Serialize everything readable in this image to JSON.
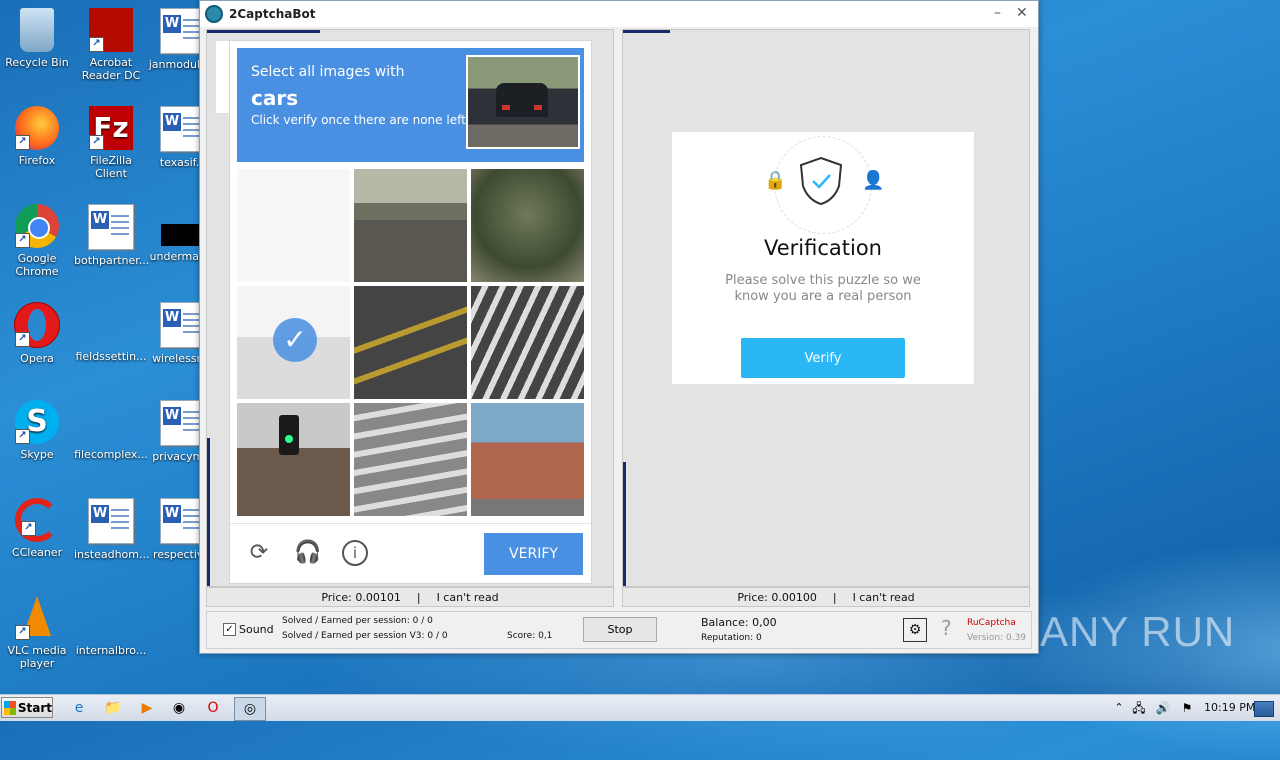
{
  "desktop": {
    "icons": [
      {
        "label": "Recycle Bin"
      },
      {
        "label": "Acrobat Reader DC"
      },
      {
        "label": "janmodule..."
      },
      {
        "label": "Firefox"
      },
      {
        "label": "FileZilla Client"
      },
      {
        "label": "texasif..."
      },
      {
        "label": "Google Chrome"
      },
      {
        "label": "bothpartner..."
      },
      {
        "label": "underman..."
      },
      {
        "label": "Opera"
      },
      {
        "label": "fieldssettin..."
      },
      {
        "label": "wirelessn..."
      },
      {
        "label": "Skype"
      },
      {
        "label": "filecomplex..."
      },
      {
        "label": "privacym..."
      },
      {
        "label": "CCleaner"
      },
      {
        "label": "insteadhom..."
      },
      {
        "label": "respectiv..."
      },
      {
        "label": "VLC media player"
      },
      {
        "label": "internalbro..."
      }
    ]
  },
  "window": {
    "title": "2CaptchaBot",
    "minimize": "–",
    "close": "✕"
  },
  "captcha": {
    "prompt": "Select all images with",
    "target": "cars",
    "instruction": "Click verify once there are none left",
    "verify_label": "VERIFY",
    "selected_tiles": [
      3
    ]
  },
  "left_status": {
    "price": "Price: 0.00101",
    "sep": "|",
    "cant_read": "I can't read"
  },
  "right_status": {
    "price": "Price: 0.00100",
    "sep": "|",
    "cant_read": "I can't read"
  },
  "verification": {
    "title": "Verification",
    "subtitle": "Please solve this puzzle so we know you are a real person",
    "button": "Verify"
  },
  "bottom": {
    "sound_label": "Sound",
    "sound_checked": true,
    "solved1": "Solved / Earned per session: 0 / 0",
    "solved2": "Solved / Earned per session V3: 0 / 0",
    "score": "Score: 0,1",
    "stop": "Stop",
    "balance": "Balance:  0,00",
    "reputation": "Reputation: 0",
    "service": "RuCaptcha",
    "version": "Version: 0.39",
    "help": "?"
  },
  "watermark": "ANY RUN",
  "taskbar": {
    "start": "Start",
    "clock": "10:19 PM"
  },
  "colors": {
    "captcha_blue": "#4a90e2",
    "verify_cyan": "#2ab7f6",
    "progress_navy": "#1b2b6a"
  }
}
